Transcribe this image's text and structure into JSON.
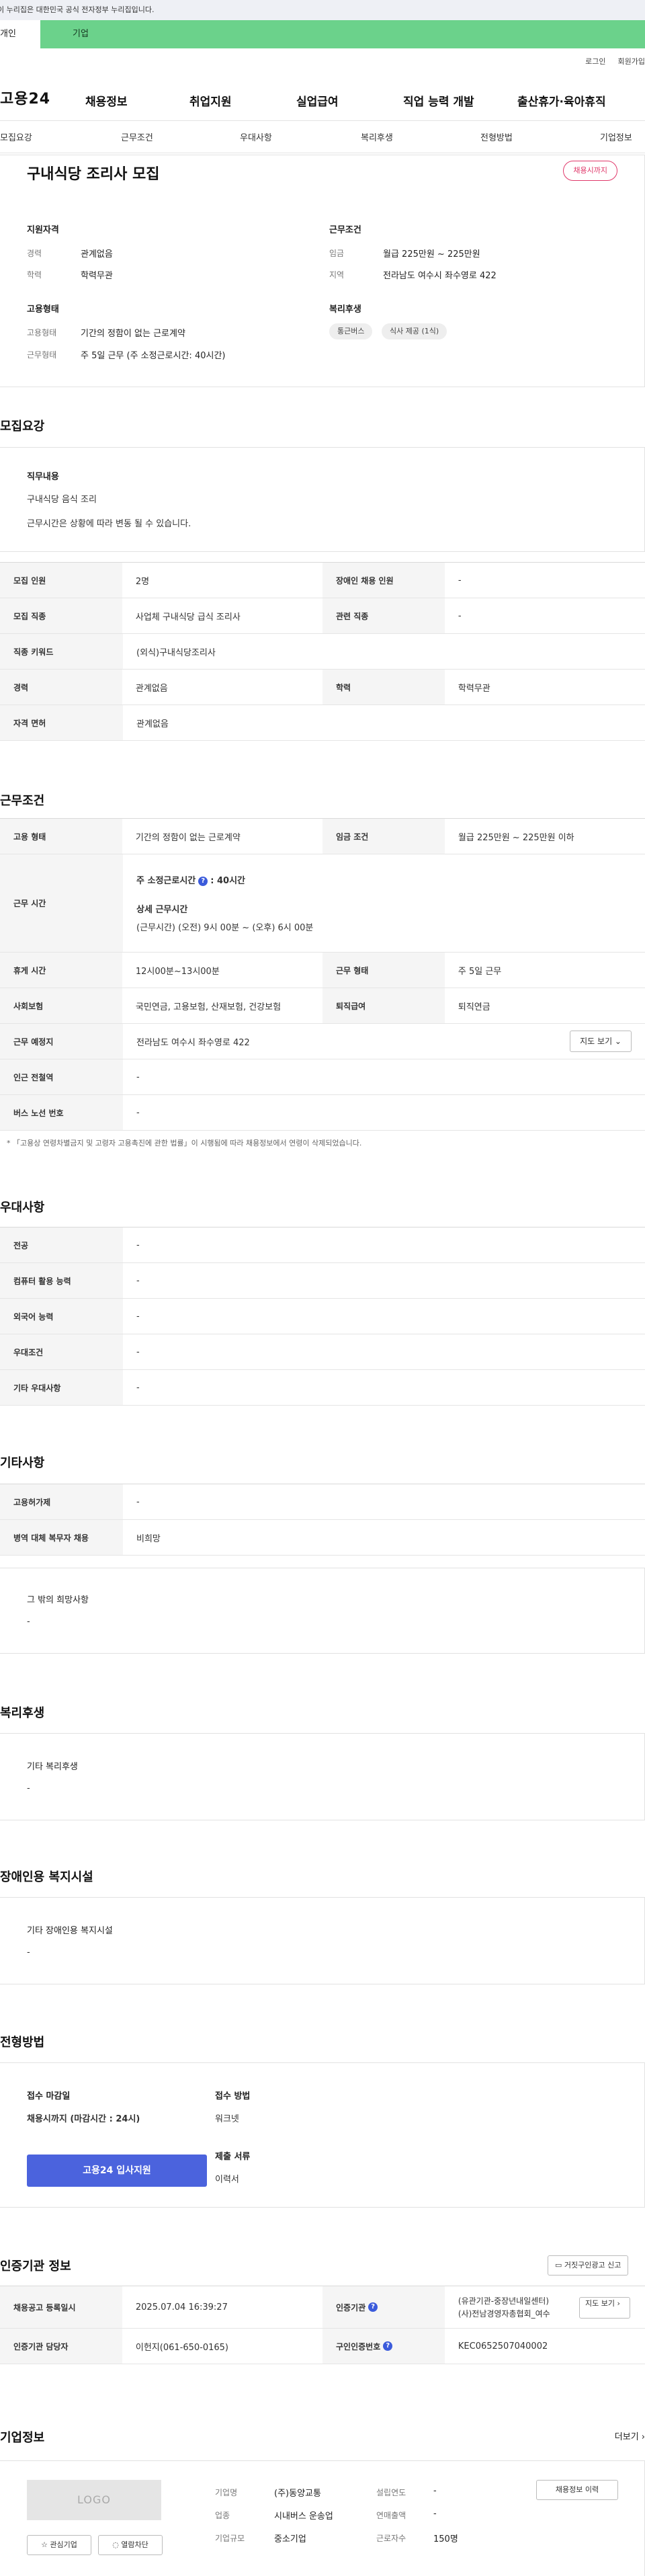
{
  "top": {
    "gov_notice": "이 누리집은 대한민국 공식 전자정부 누리집입니다.",
    "tab_person": "개인",
    "tab_biz": "기업",
    "login": "로그인",
    "signup": "회원가입"
  },
  "nav": {
    "logo": "고용24",
    "items": [
      "채용정보",
      "취업지원",
      "실업급여",
      "직업 능력 개발",
      "출산휴가·육아휴직"
    ]
  },
  "subnav": [
    "모집요강",
    "근무조건",
    "우대사항",
    "복리후생",
    "전형방법",
    "기업정보"
  ],
  "summary": {
    "title": "구내식당 조리사 모집",
    "badge": "채용시까지",
    "qual_title": "지원자격",
    "career_label": "경력",
    "career_val": "관계없음",
    "edu_label": "학력",
    "edu_val": "학력무관",
    "emp_title": "고용형태",
    "emptype_label": "고용형태",
    "emptype_val": "기간의 정함이 없는 근로계약",
    "workform_label": "근무형태",
    "workform_val": "주 5일 근무 (주 소정근로시간: 40시간)",
    "cond_title": "근무조건",
    "wage_label": "임금",
    "wage_val": "월급 225만원 ~ 225만원",
    "region_label": "지역",
    "region_val": "전라남도 여수시 좌수영로 422",
    "welfare_title": "복리후생",
    "chips": [
      "통근버스",
      "식사 제공 (1식)"
    ]
  },
  "recruit": {
    "title": "모집요강",
    "duty_title": "직무내용",
    "duty_line1": "구내식당 음식 조리",
    "duty_line2": "근무시간은 상황에 따라 변동 될 수 있습니다.",
    "rows": [
      [
        "모집 인원",
        "2명",
        "장애인 채용 인원",
        "-"
      ],
      [
        "모집 직종",
        "사업체 구내식당 급식 조리사",
        "관련 직종",
        "-"
      ]
    ],
    "keyword_label": "직종 키워드",
    "keyword_val": "(외식)구내식당조리사",
    "career_label": "경력",
    "career_val": "관계없음",
    "edu_label": "학력",
    "edu_val": "학력무관",
    "license_label": "자격 면허",
    "license_val": "관계없음"
  },
  "work": {
    "title": "근무조건",
    "emp_label": "고용 형태",
    "emp_val": "기간의 정함이 없는 근로계약",
    "wage_label": "임금 조건",
    "wage_val": "월급 225만원 ~ 225만원 이하",
    "hours_label": "근무 시간",
    "hours_std": "주 소정근로시간",
    "hours_std_val": ": 40시간",
    "hours_detail_title": "상세 근무시간",
    "hours_detail": "(근무시간) (오전) 9시 00분 ~ (오후) 6시 00분",
    "break_label": "휴게 시간",
    "break_val": "12시00분~13시00분",
    "workform_label": "근무 형태",
    "workform_val": "주 5일 근무",
    "insurance_label": "사회보험",
    "insurance_val": "국민연금, 고용보험, 산재보험, 건강보험",
    "severance_label": "퇴직급여",
    "severance_val": "퇴직연금",
    "place_label": "근무 예정지",
    "place_val": "전라남도 여수시 좌수영로 422",
    "map_btn": "지도 보기 ⌄",
    "subway_label": "인근 전철역",
    "subway_val": "-",
    "bus_label": "버스 노선 번호",
    "bus_val": "-",
    "footnote": "* 「고용상 연령차별금지 및 고령자 고용촉진에 관한 법률」이 시행됨에 따라 채용정보에서 연령이 삭제되었습니다."
  },
  "pref": {
    "title": "우대사항",
    "rows": [
      [
        "전공",
        "-"
      ],
      [
        "컴퓨터 활용 능력",
        "-"
      ],
      [
        "외국어 능력",
        "-"
      ],
      [
        "우대조건",
        "-"
      ],
      [
        "기타 우대사항",
        "-"
      ]
    ]
  },
  "etc": {
    "title": "기타사항",
    "rows": [
      [
        "고용허가제",
        "-"
      ],
      [
        "병역 대체 복무자 채용",
        "비희망"
      ]
    ],
    "other_title": "그 밖의 희망사항",
    "other_val": "-"
  },
  "welfare": {
    "title": "복리후생",
    "box_title": "기타 복리후생",
    "box_val": "-"
  },
  "disability": {
    "title": "장애인용 복지시설",
    "box_title": "기타 장애인용 복지시설",
    "box_val": "-"
  },
  "process": {
    "title": "전형방법",
    "deadline_title": "접수 마감일",
    "deadline_val": "채용시까지 (마감시간 : 24시)",
    "apply_btn": "고용24 입사지원",
    "method_title": "접수 방법",
    "method_val": "워크넷",
    "docs_title": "제출 서류",
    "docs_val": "이력서"
  },
  "cert": {
    "title": "인증기관 정보",
    "report_btn": "거짓구인광고 신고",
    "reg_label": "채용공고 등록일시",
    "reg_val": "2025.07.04 16:39:27",
    "org_label": "인증기관",
    "org_line1": "(유관기관-중장년내일센터)",
    "org_line2": "(사)전남경영자총협회_여수",
    "map_btn": "지도 보기",
    "manager_label": "인증기관 담당자",
    "manager_val": "이헌지(061-650-0165)",
    "certno_label": "구인인증번호",
    "certno_val": "KEC0652507040002"
  },
  "company": {
    "title": "기업정보",
    "more": "더보기 ›",
    "logo": "LOGO",
    "fav_btn": "☆ 관심기업",
    "block_btn": "◌ 열람차단",
    "name_label": "기업명",
    "name_val": "(주)동양교통",
    "found_label": "설립연도",
    "found_val": "-",
    "industry_label": "업종",
    "industry_val": "시내버스 운송업",
    "sales_label": "연매출액",
    "sales_val": "-",
    "scale_label": "기업규모",
    "scale_val": "중소기업",
    "staff_label": "근로자수",
    "staff_val": "150명",
    "history_btn": "채용정보 이력"
  }
}
